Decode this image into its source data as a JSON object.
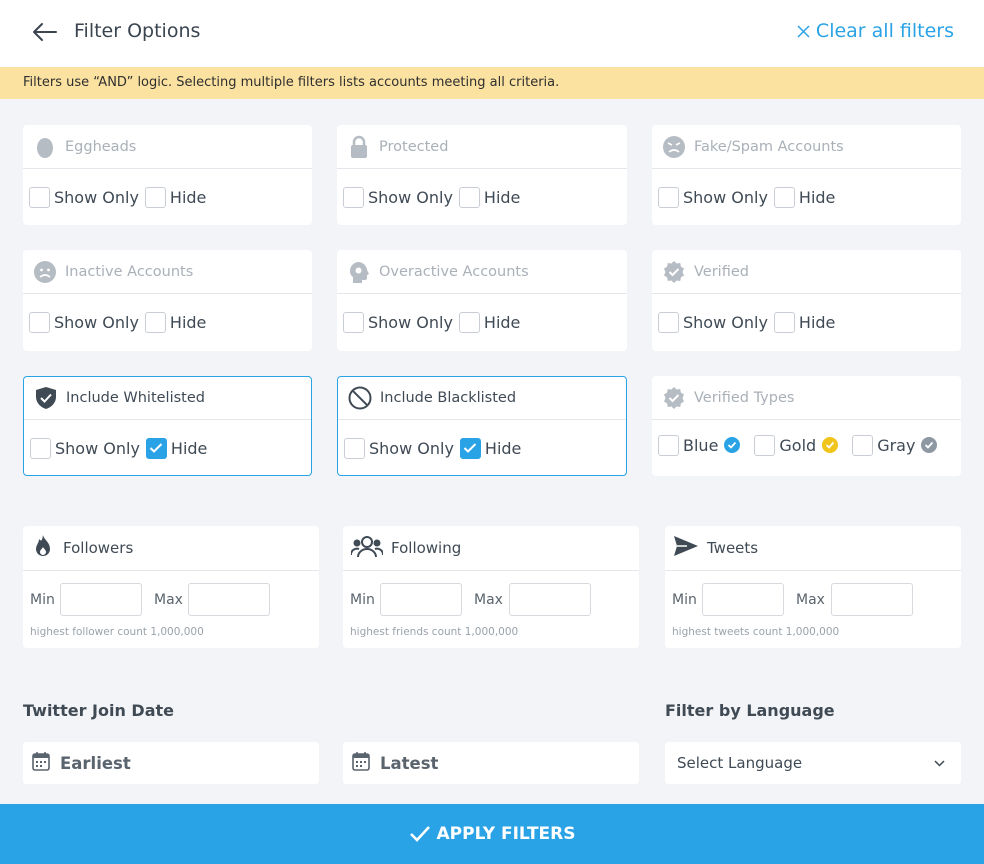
{
  "header": {
    "title": "Filter Options",
    "clear_label": "Clear all filters"
  },
  "notice": "Filters use “AND” logic. Selecting multiple filters lists accounts meeting all criteria.",
  "cards": {
    "eggheads": {
      "title": "Eggheads",
      "show_only": "Show Only",
      "hide": "Hide",
      "show_only_checked": false,
      "hide_checked": false
    },
    "protected": {
      "title": "Protected",
      "show_only": "Show Only",
      "hide": "Hide",
      "show_only_checked": false,
      "hide_checked": false
    },
    "fake_spam": {
      "title": "Fake/Spam Accounts",
      "show_only": "Show Only",
      "hide": "Hide",
      "show_only_checked": false,
      "hide_checked": false
    },
    "inactive": {
      "title": "Inactive Accounts",
      "show_only": "Show Only",
      "hide": "Hide",
      "show_only_checked": false,
      "hide_checked": false
    },
    "overactive": {
      "title": "Overactive Accounts",
      "show_only": "Show Only",
      "hide": "Hide",
      "show_only_checked": false,
      "hide_checked": false
    },
    "verified": {
      "title": "Verified",
      "show_only": "Show Only",
      "hide": "Hide",
      "show_only_checked": false,
      "hide_checked": false
    },
    "whitelisted": {
      "title": "Include Whitelisted",
      "show_only": "Show Only",
      "hide": "Hide",
      "show_only_checked": false,
      "hide_checked": true
    },
    "blacklisted": {
      "title": "Include Blacklisted",
      "show_only": "Show Only",
      "hide": "Hide",
      "show_only_checked": false,
      "hide_checked": true
    },
    "verified_types": {
      "title": "Verified Types",
      "blue": "Blue",
      "gold": "Gold",
      "gray": "Gray"
    }
  },
  "ranges": {
    "followers": {
      "title": "Followers",
      "min": "Min",
      "max": "Max",
      "hint": "highest follower count 1,000,000"
    },
    "following": {
      "title": "Following",
      "min": "Min",
      "max": "Max",
      "hint": "highest friends count 1,000,000"
    },
    "tweets": {
      "title": "Tweets",
      "min": "Min",
      "max": "Max",
      "hint": "highest tweets count 1,000,000"
    }
  },
  "join_date": {
    "label": "Twitter Join Date",
    "earliest": "Earliest",
    "latest": "Latest"
  },
  "language": {
    "label": "Filter by Language",
    "placeholder": "Select Language"
  },
  "apply_label": "APPLY FILTERS",
  "colors": {
    "accent": "#2aa3e6",
    "notice_bg": "#fbe2a1",
    "gold": "#f0c419",
    "gray": "#8e98a3",
    "text": "#3f4a55",
    "icon_muted": "#b6bcc3"
  }
}
